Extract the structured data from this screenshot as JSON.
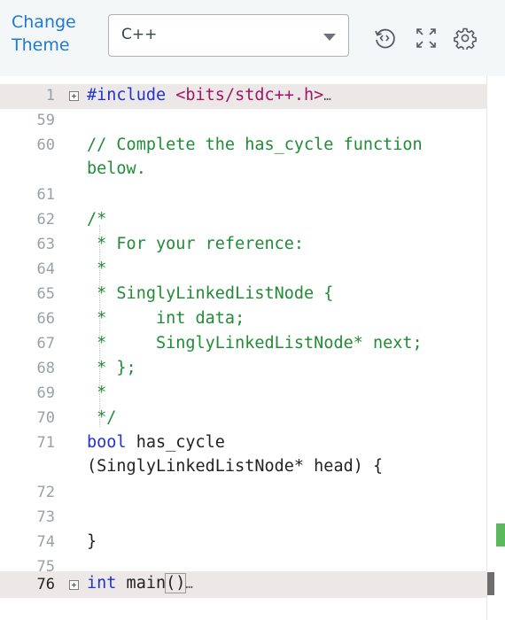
{
  "toolbar": {
    "change_theme_line1": "Change",
    "change_theme_line2": "Theme",
    "language": "C++"
  },
  "editor": {
    "lines": [
      {
        "num": "1",
        "fold": true
      },
      {
        "num": "59"
      },
      {
        "num": "60"
      },
      {
        "num": "61"
      },
      {
        "num": "62"
      },
      {
        "num": "63"
      },
      {
        "num": "64"
      },
      {
        "num": "65"
      },
      {
        "num": "66"
      },
      {
        "num": "67"
      },
      {
        "num": "68"
      },
      {
        "num": "69"
      },
      {
        "num": "70"
      },
      {
        "num": "71"
      },
      {
        "num": "72"
      },
      {
        "num": "73"
      },
      {
        "num": "74"
      },
      {
        "num": "75"
      },
      {
        "num": "76",
        "fold": true,
        "active": true
      }
    ],
    "code": {
      "l1_directive": "#include ",
      "l1_header": "<bits/stdc++.h>",
      "l1_ellipsis": "…",
      "l60a": "// Complete the has_cycle function",
      "l60b": "below.",
      "l62": "/*",
      "l63": " * For your reference:",
      "l64": " *",
      "l65": " * SinglyLinkedListNode {",
      "l66_star": " *",
      "l66_rest": "     int data;",
      "l67_star": " *",
      "l67_rest": "     SinglyLinkedListNode* next;",
      "l68": " * };",
      "l69": " *",
      "l70": " */",
      "l71_kw": "bool",
      "l71_rest": " has_cycle",
      "l71b": "(SinglyLinkedListNode* head) {",
      "l74": "}",
      "l76_kw": "int",
      "l76_fn": " main",
      "l76_parens": "()",
      "l76_ellipsis": "…"
    }
  },
  "icons": [
    "reset-code-icon",
    "fullscreen-icon",
    "settings-gear-icon"
  ],
  "colors": {
    "toolbar_bg": "#f3f7f7",
    "link": "#1f7ad1",
    "keyword": "#2233cc",
    "string": "#a31563",
    "comment": "#208c36",
    "highlight_row": "#ede8e8"
  }
}
